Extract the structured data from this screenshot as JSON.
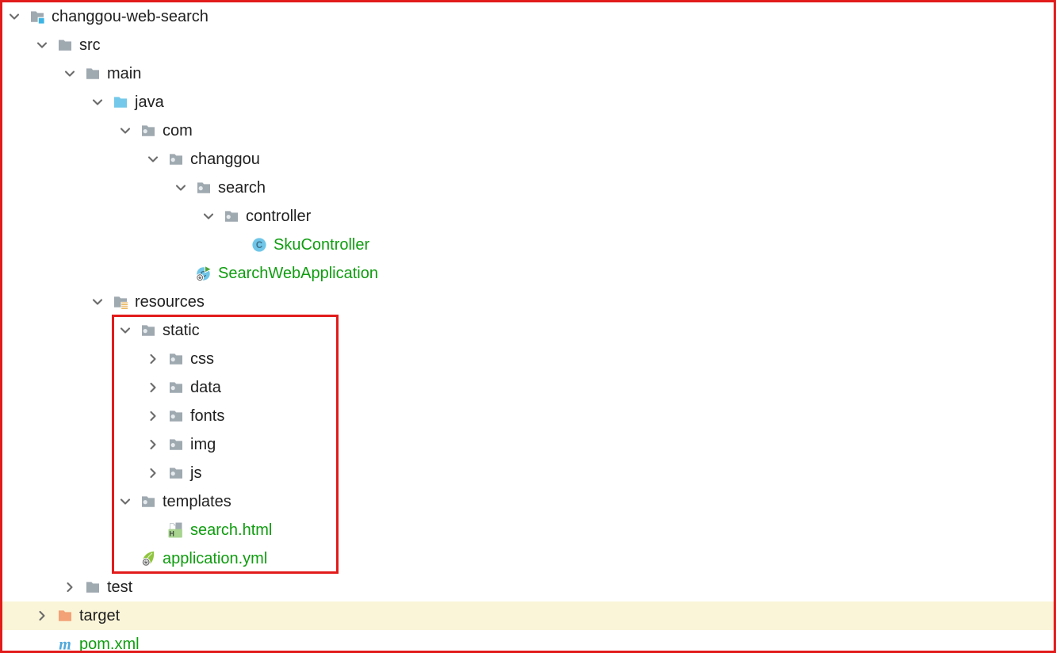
{
  "panel": {
    "description": "IDE project tree view",
    "project_name": "changgou-web-search"
  },
  "colors": {
    "default_text": "#212121",
    "green_file_text": "#0f9d0f",
    "row_highlight": "#faf5d8",
    "annotation_red": "#e21b1b",
    "folder_gray": "#9fa9b0",
    "sources_root_blue": "#74c9ea",
    "excluded_orange": "#f2a276",
    "chevron_gray": "#6b6b6b"
  },
  "tree": {
    "rows": [
      {
        "label": "changgou-web-search",
        "depth": 0,
        "icon": "folder-project",
        "chevron": "expanded",
        "color": "default",
        "highlighted": false
      },
      {
        "label": "src",
        "depth": 1,
        "icon": "folder",
        "chevron": "expanded",
        "color": "default",
        "highlighted": false
      },
      {
        "label": "main",
        "depth": 2,
        "icon": "folder",
        "chevron": "expanded",
        "color": "default",
        "highlighted": false
      },
      {
        "label": "java",
        "depth": 3,
        "icon": "folder-sources",
        "chevron": "expanded",
        "color": "default",
        "highlighted": false
      },
      {
        "label": "com",
        "depth": 4,
        "icon": "folder-package",
        "chevron": "expanded",
        "color": "default",
        "highlighted": false
      },
      {
        "label": "changgou",
        "depth": 5,
        "icon": "folder-package",
        "chevron": "expanded",
        "color": "default",
        "highlighted": false
      },
      {
        "label": "search",
        "depth": 6,
        "icon": "folder-package",
        "chevron": "expanded",
        "color": "default",
        "highlighted": false
      },
      {
        "label": "controller",
        "depth": 7,
        "icon": "folder-package",
        "chevron": "expanded",
        "color": "default",
        "highlighted": false
      },
      {
        "label": "SkuController",
        "depth": 8,
        "icon": "class",
        "chevron": "none",
        "color": "green",
        "highlighted": false
      },
      {
        "label": "SearchWebApplication",
        "depth": 6,
        "icon": "boot-class",
        "chevron": "none",
        "color": "green",
        "highlighted": false
      },
      {
        "label": "resources",
        "depth": 3,
        "icon": "folder-resources",
        "chevron": "expanded",
        "color": "default",
        "highlighted": false
      },
      {
        "label": "static",
        "depth": 4,
        "icon": "folder-package",
        "chevron": "expanded",
        "color": "default",
        "highlighted": false
      },
      {
        "label": "css",
        "depth": 5,
        "icon": "folder-package",
        "chevron": "collapsed",
        "color": "default",
        "highlighted": false
      },
      {
        "label": "data",
        "depth": 5,
        "icon": "folder-package",
        "chevron": "collapsed",
        "color": "default",
        "highlighted": false
      },
      {
        "label": "fonts",
        "depth": 5,
        "icon": "folder-package",
        "chevron": "collapsed",
        "color": "default",
        "highlighted": false
      },
      {
        "label": "img",
        "depth": 5,
        "icon": "folder-package",
        "chevron": "collapsed",
        "color": "default",
        "highlighted": false
      },
      {
        "label": "js",
        "depth": 5,
        "icon": "folder-package",
        "chevron": "collapsed",
        "color": "default",
        "highlighted": false
      },
      {
        "label": "templates",
        "depth": 4,
        "icon": "folder-package",
        "chevron": "expanded",
        "color": "default",
        "highlighted": false
      },
      {
        "label": "search.html",
        "depth": 5,
        "icon": "html-file",
        "chevron": "none",
        "color": "green",
        "highlighted": false
      },
      {
        "label": "application.yml",
        "depth": 4,
        "icon": "spring-config",
        "chevron": "none",
        "color": "green",
        "highlighted": false
      },
      {
        "label": "test",
        "depth": 2,
        "icon": "folder",
        "chevron": "collapsed",
        "color": "default",
        "highlighted": false
      },
      {
        "label": "target",
        "depth": 1,
        "icon": "folder-excluded",
        "chevron": "collapsed",
        "color": "default",
        "highlighted": true
      },
      {
        "label": "pom.xml",
        "depth": 1,
        "icon": "maven",
        "chevron": "none",
        "color": "green",
        "highlighted": false
      }
    ]
  },
  "annotation": {
    "shape": "rectangle",
    "color": "#e21b1b",
    "surrounds": [
      "static",
      "css",
      "data",
      "fonts",
      "img",
      "js",
      "templates",
      "search.html",
      "application.yml"
    ]
  }
}
